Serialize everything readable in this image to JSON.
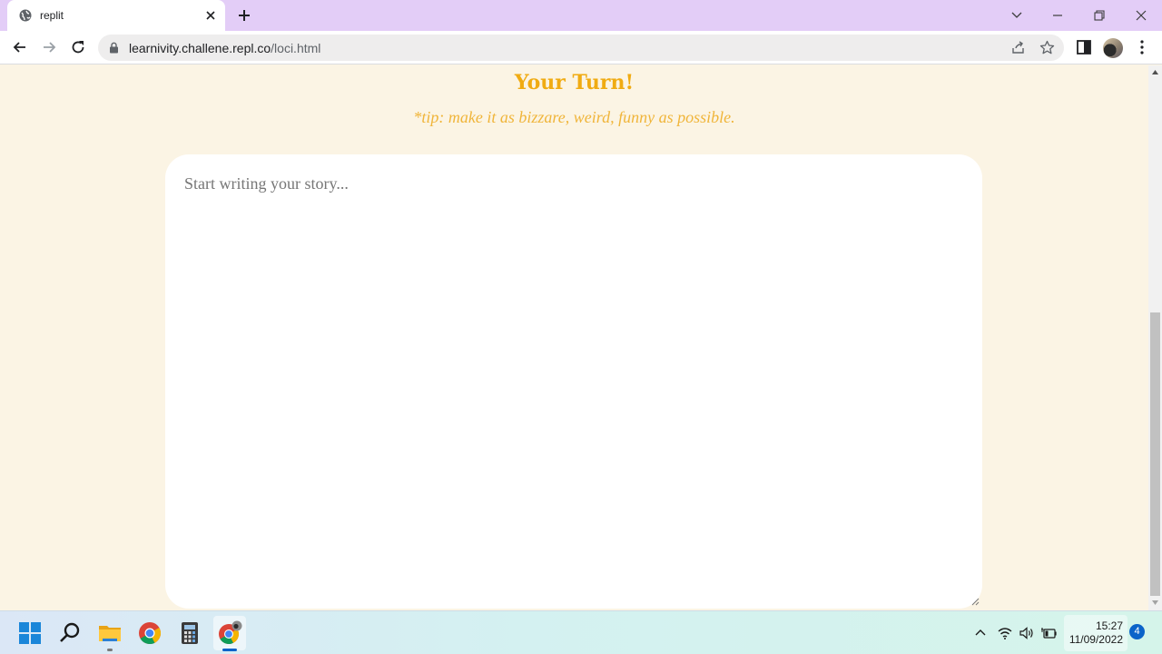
{
  "browser": {
    "tab": {
      "title": "replit"
    },
    "address_bar": {
      "url_host": "learnivity.challene.repl.co",
      "url_path": "/loci.html"
    }
  },
  "page": {
    "heading": "Your Turn!",
    "tip": "*tip: make it as bizzare, weird, funny as possible.",
    "story_input": {
      "placeholder": "Start writing your story...",
      "value": ""
    }
  },
  "taskbar": {
    "apps": [
      "start-icon",
      "search-icon",
      "file-explorer-icon",
      "chrome-icon",
      "calculator-icon",
      "chrome-profile-icon"
    ],
    "clock": {
      "time": "15:27",
      "date": "11/09/2022"
    },
    "notification_count": "4"
  },
  "colors": {
    "accent": "#f0ab12",
    "page_background": "#fbf4e4",
    "titlebar": "#e3cdf7"
  }
}
